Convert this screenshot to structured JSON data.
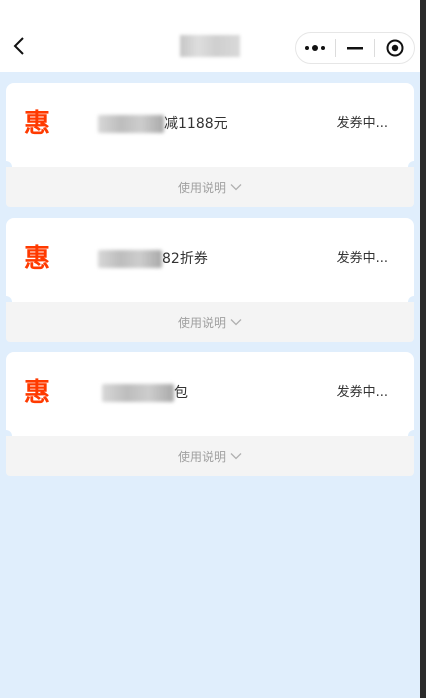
{
  "header": {
    "title": "",
    "back_icon": "chevron-left-icon",
    "capsule": {
      "more_icon": "more-dots-icon",
      "minimize_icon": "minimize-icon",
      "close_icon": "target-close-icon"
    }
  },
  "coupons": [
    {
      "badge": "惠",
      "name": "减1188元",
      "status": "发券中...",
      "usage_label": "使用说明"
    },
    {
      "badge": "惠",
      "name": "82折券",
      "status": "发券中...",
      "usage_label": "使用说明"
    },
    {
      "badge": "惠",
      "name": "包",
      "status": "发券中...",
      "usage_label": "使用说明"
    }
  ],
  "colors": {
    "accent": "#ff3a00",
    "page_bg": "#e0eefc",
    "card_bg": "#ffffff",
    "footer_bg": "#f4f4f4"
  }
}
